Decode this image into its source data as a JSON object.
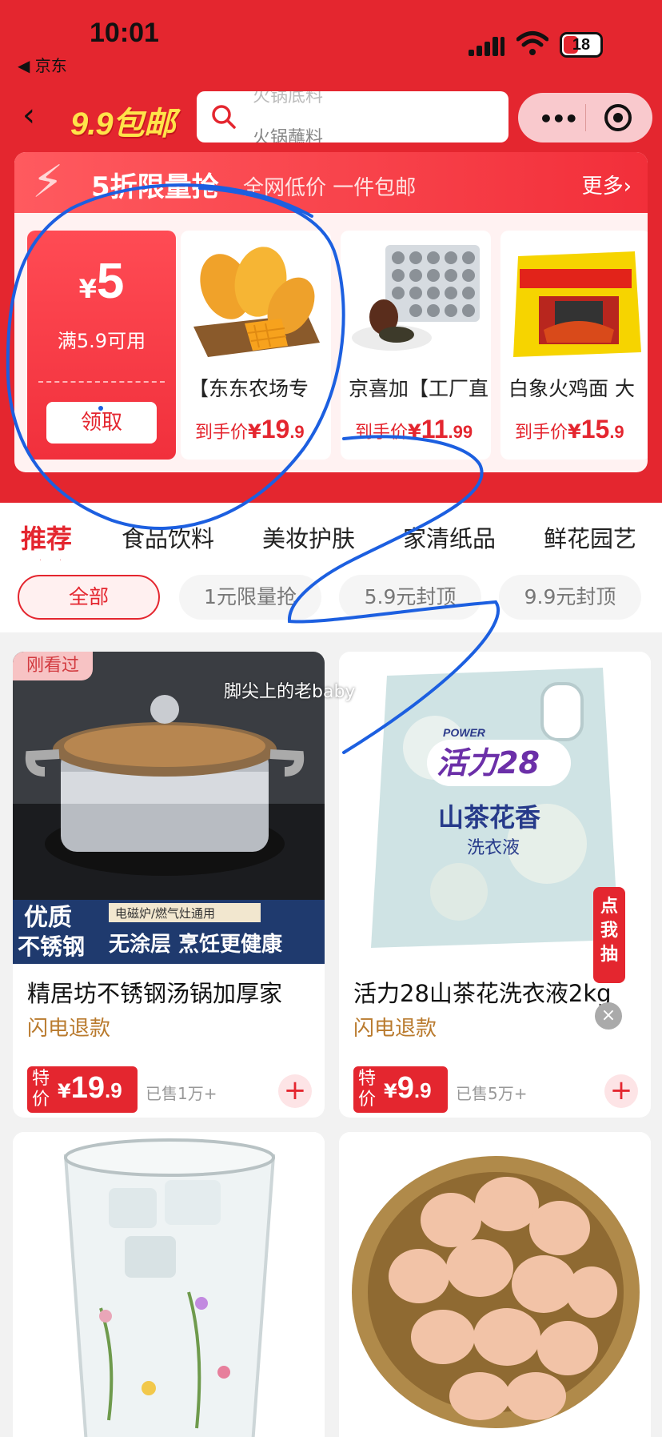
{
  "status_bar": {
    "time": "10:01",
    "back_app": "◀ 京东",
    "battery": "18"
  },
  "nav": {
    "logo": "9.9包邮",
    "search_placeholder_prev": "火锅底料",
    "search_placeholder": "火锅蘸料"
  },
  "flash_sale": {
    "title": "5折限量抢",
    "subtitle": "全网低价 一件包邮",
    "more": "更多›",
    "coupon": {
      "currency": "¥",
      "amount": "5",
      "condition": "满5.9可用",
      "button": "领取"
    },
    "products": [
      {
        "name": "【东东农场专",
        "price_label": "到手价",
        "currency": "¥",
        "price_int": "19",
        "price_dec": ".9",
        "image": "mango-image"
      },
      {
        "name": "京喜加【工厂直",
        "price_label": "到手价",
        "currency": "¥",
        "price_int": "11",
        "price_dec": ".99",
        "image": "preserved-egg-image"
      },
      {
        "name": "白象火鸡面 大",
        "price_label": "到手价",
        "currency": "¥",
        "price_int": "15",
        "price_dec": ".9",
        "image": "noodle-pack-image"
      }
    ]
  },
  "categories": [
    "推荐",
    "食品饮料",
    "美妆护肤",
    "家清纸品",
    "鲜花园艺"
  ],
  "filters": [
    "全部",
    "1元限量抢",
    "5.9元封顶",
    "9.9元封顶"
  ],
  "products": [
    {
      "seen_badge": "刚看过",
      "name": "精居坊不锈钢汤锅加厚家",
      "tag": "闪电退款",
      "special": "特价",
      "currency": "¥",
      "price_int": "19",
      "price_dec": ".9",
      "sold": "已售1万+",
      "image_text": [
        "优质",
        "不锈钢",
        "电磁炉/燃气灶通用",
        "无涂层 烹饪更健康"
      ]
    },
    {
      "name": "活力28山茶花洗衣液2kg",
      "tag": "闪电退款",
      "special": "特价",
      "currency": "¥",
      "price_int": "9",
      "price_dec": ".9",
      "sold": "已售5万+",
      "image_text": [
        "活力28",
        "山茶花香",
        "洗衣液",
        "POWER"
      ]
    },
    {
      "name": "",
      "image": "glass-cup-image"
    },
    {
      "name": "",
      "image": "eggs-basket-image"
    }
  ],
  "overlay": {
    "watermark": "脚尖上的老baby",
    "float_tag": "点我抽",
    "close": "×"
  },
  "colors": {
    "brand_red": "#e4262f",
    "logo_yellow": "#ffe34a",
    "tag_gold": "#b97a2d",
    "scribble_blue": "#1c5fe0"
  }
}
